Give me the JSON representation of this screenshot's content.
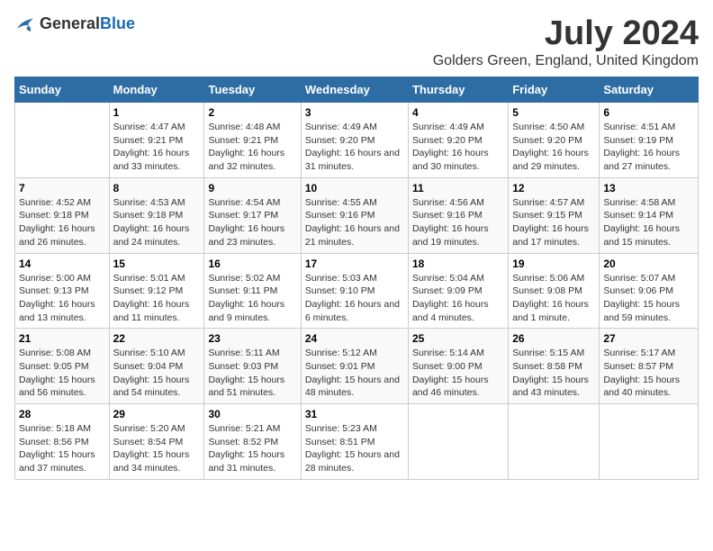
{
  "logo": {
    "general": "General",
    "blue": "Blue"
  },
  "title": "July 2024",
  "subtitle": "Golders Green, England, United Kingdom",
  "weekdays": [
    "Sunday",
    "Monday",
    "Tuesday",
    "Wednesday",
    "Thursday",
    "Friday",
    "Saturday"
  ],
  "rows": [
    [
      {
        "day": "",
        "sunrise": "",
        "sunset": "",
        "daylight": ""
      },
      {
        "day": "1",
        "sunrise": "Sunrise: 4:47 AM",
        "sunset": "Sunset: 9:21 PM",
        "daylight": "Daylight: 16 hours and 33 minutes."
      },
      {
        "day": "2",
        "sunrise": "Sunrise: 4:48 AM",
        "sunset": "Sunset: 9:21 PM",
        "daylight": "Daylight: 16 hours and 32 minutes."
      },
      {
        "day": "3",
        "sunrise": "Sunrise: 4:49 AM",
        "sunset": "Sunset: 9:20 PM",
        "daylight": "Daylight: 16 hours and 31 minutes."
      },
      {
        "day": "4",
        "sunrise": "Sunrise: 4:49 AM",
        "sunset": "Sunset: 9:20 PM",
        "daylight": "Daylight: 16 hours and 30 minutes."
      },
      {
        "day": "5",
        "sunrise": "Sunrise: 4:50 AM",
        "sunset": "Sunset: 9:20 PM",
        "daylight": "Daylight: 16 hours and 29 minutes."
      },
      {
        "day": "6",
        "sunrise": "Sunrise: 4:51 AM",
        "sunset": "Sunset: 9:19 PM",
        "daylight": "Daylight: 16 hours and 27 minutes."
      }
    ],
    [
      {
        "day": "7",
        "sunrise": "Sunrise: 4:52 AM",
        "sunset": "Sunset: 9:18 PM",
        "daylight": "Daylight: 16 hours and 26 minutes."
      },
      {
        "day": "8",
        "sunrise": "Sunrise: 4:53 AM",
        "sunset": "Sunset: 9:18 PM",
        "daylight": "Daylight: 16 hours and 24 minutes."
      },
      {
        "day": "9",
        "sunrise": "Sunrise: 4:54 AM",
        "sunset": "Sunset: 9:17 PM",
        "daylight": "Daylight: 16 hours and 23 minutes."
      },
      {
        "day": "10",
        "sunrise": "Sunrise: 4:55 AM",
        "sunset": "Sunset: 9:16 PM",
        "daylight": "Daylight: 16 hours and 21 minutes."
      },
      {
        "day": "11",
        "sunrise": "Sunrise: 4:56 AM",
        "sunset": "Sunset: 9:16 PM",
        "daylight": "Daylight: 16 hours and 19 minutes."
      },
      {
        "day": "12",
        "sunrise": "Sunrise: 4:57 AM",
        "sunset": "Sunset: 9:15 PM",
        "daylight": "Daylight: 16 hours and 17 minutes."
      },
      {
        "day": "13",
        "sunrise": "Sunrise: 4:58 AM",
        "sunset": "Sunset: 9:14 PM",
        "daylight": "Daylight: 16 hours and 15 minutes."
      }
    ],
    [
      {
        "day": "14",
        "sunrise": "Sunrise: 5:00 AM",
        "sunset": "Sunset: 9:13 PM",
        "daylight": "Daylight: 16 hours and 13 minutes."
      },
      {
        "day": "15",
        "sunrise": "Sunrise: 5:01 AM",
        "sunset": "Sunset: 9:12 PM",
        "daylight": "Daylight: 16 hours and 11 minutes."
      },
      {
        "day": "16",
        "sunrise": "Sunrise: 5:02 AM",
        "sunset": "Sunset: 9:11 PM",
        "daylight": "Daylight: 16 hours and 9 minutes."
      },
      {
        "day": "17",
        "sunrise": "Sunrise: 5:03 AM",
        "sunset": "Sunset: 9:10 PM",
        "daylight": "Daylight: 16 hours and 6 minutes."
      },
      {
        "day": "18",
        "sunrise": "Sunrise: 5:04 AM",
        "sunset": "Sunset: 9:09 PM",
        "daylight": "Daylight: 16 hours and 4 minutes."
      },
      {
        "day": "19",
        "sunrise": "Sunrise: 5:06 AM",
        "sunset": "Sunset: 9:08 PM",
        "daylight": "Daylight: 16 hours and 1 minute."
      },
      {
        "day": "20",
        "sunrise": "Sunrise: 5:07 AM",
        "sunset": "Sunset: 9:06 PM",
        "daylight": "Daylight: 15 hours and 59 minutes."
      }
    ],
    [
      {
        "day": "21",
        "sunrise": "Sunrise: 5:08 AM",
        "sunset": "Sunset: 9:05 PM",
        "daylight": "Daylight: 15 hours and 56 minutes."
      },
      {
        "day": "22",
        "sunrise": "Sunrise: 5:10 AM",
        "sunset": "Sunset: 9:04 PM",
        "daylight": "Daylight: 15 hours and 54 minutes."
      },
      {
        "day": "23",
        "sunrise": "Sunrise: 5:11 AM",
        "sunset": "Sunset: 9:03 PM",
        "daylight": "Daylight: 15 hours and 51 minutes."
      },
      {
        "day": "24",
        "sunrise": "Sunrise: 5:12 AM",
        "sunset": "Sunset: 9:01 PM",
        "daylight": "Daylight: 15 hours and 48 minutes."
      },
      {
        "day": "25",
        "sunrise": "Sunrise: 5:14 AM",
        "sunset": "Sunset: 9:00 PM",
        "daylight": "Daylight: 15 hours and 46 minutes."
      },
      {
        "day": "26",
        "sunrise": "Sunrise: 5:15 AM",
        "sunset": "Sunset: 8:58 PM",
        "daylight": "Daylight: 15 hours and 43 minutes."
      },
      {
        "day": "27",
        "sunrise": "Sunrise: 5:17 AM",
        "sunset": "Sunset: 8:57 PM",
        "daylight": "Daylight: 15 hours and 40 minutes."
      }
    ],
    [
      {
        "day": "28",
        "sunrise": "Sunrise: 5:18 AM",
        "sunset": "Sunset: 8:56 PM",
        "daylight": "Daylight: 15 hours and 37 minutes."
      },
      {
        "day": "29",
        "sunrise": "Sunrise: 5:20 AM",
        "sunset": "Sunset: 8:54 PM",
        "daylight": "Daylight: 15 hours and 34 minutes."
      },
      {
        "day": "30",
        "sunrise": "Sunrise: 5:21 AM",
        "sunset": "Sunset: 8:52 PM",
        "daylight": "Daylight: 15 hours and 31 minutes."
      },
      {
        "day": "31",
        "sunrise": "Sunrise: 5:23 AM",
        "sunset": "Sunset: 8:51 PM",
        "daylight": "Daylight: 15 hours and 28 minutes."
      },
      {
        "day": "",
        "sunrise": "",
        "sunset": "",
        "daylight": ""
      },
      {
        "day": "",
        "sunrise": "",
        "sunset": "",
        "daylight": ""
      },
      {
        "day": "",
        "sunrise": "",
        "sunset": "",
        "daylight": ""
      }
    ]
  ]
}
